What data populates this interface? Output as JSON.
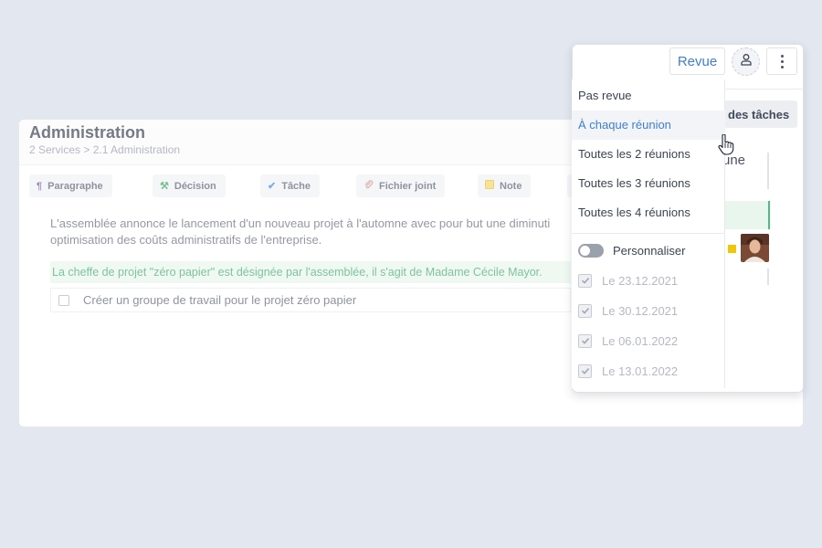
{
  "background_section": {
    "title": "Administration",
    "breadcrumb": "2 Services > 2.1 Administration",
    "toolbar": [
      {
        "label": "Paragraphe",
        "icon": "pilcrow-icon",
        "icon_glyph": "¶",
        "color": "#6b4fa0"
      },
      {
        "label": "Décision",
        "icon": "gavel-icon",
        "icon_glyph": "⚒",
        "color": "#2f9e5c"
      },
      {
        "label": "Tâche",
        "icon": "check-icon",
        "icon_glyph": "✔",
        "color": "#3f7fd0"
      },
      {
        "label": "Fichier joint",
        "icon": "paperclip-icon",
        "icon_glyph": "🖇",
        "color": "#d88a8a"
      },
      {
        "label": "Note",
        "icon": "note-icon",
        "icon_glyph": "▤",
        "color": "#e2b93b"
      }
    ],
    "paragraph_line1": "L'assemblée annonce le lancement d'un nouveau projet à l'automne avec pour but une diminuti",
    "paragraph_line2": "optimisation des coûts administratifs de l'entreprise.",
    "decision_text": "La cheffe de projet \"zéro papier\" est désignée par l'assemblée, il s'agit de Madame Cécile Mayor.",
    "task_text": "Créer un groupe de travail pour le projet zéro papier"
  },
  "panel": {
    "revue_button": "Revue",
    "tasks_chip": "des tâches",
    "side_text": "une"
  },
  "dropdown": {
    "items": [
      {
        "label": "Pas revue"
      },
      {
        "label": "À chaque réunion",
        "active": true
      },
      {
        "label": "Toutes les 2 réunions"
      },
      {
        "label": "Toutes les 3 réunions"
      },
      {
        "label": "Toutes les 4 réunions"
      }
    ],
    "toggle_label": "Personnaliser",
    "toggle_on": false,
    "dates": [
      "Le 23.12.2021",
      "Le 30.12.2021",
      "Le 06.01.2022",
      "Le 13.01.2022"
    ]
  },
  "colors": {
    "accent": "#3f7fd0",
    "decision_green": "#37a36a",
    "page_background": "#e3e7ef"
  }
}
